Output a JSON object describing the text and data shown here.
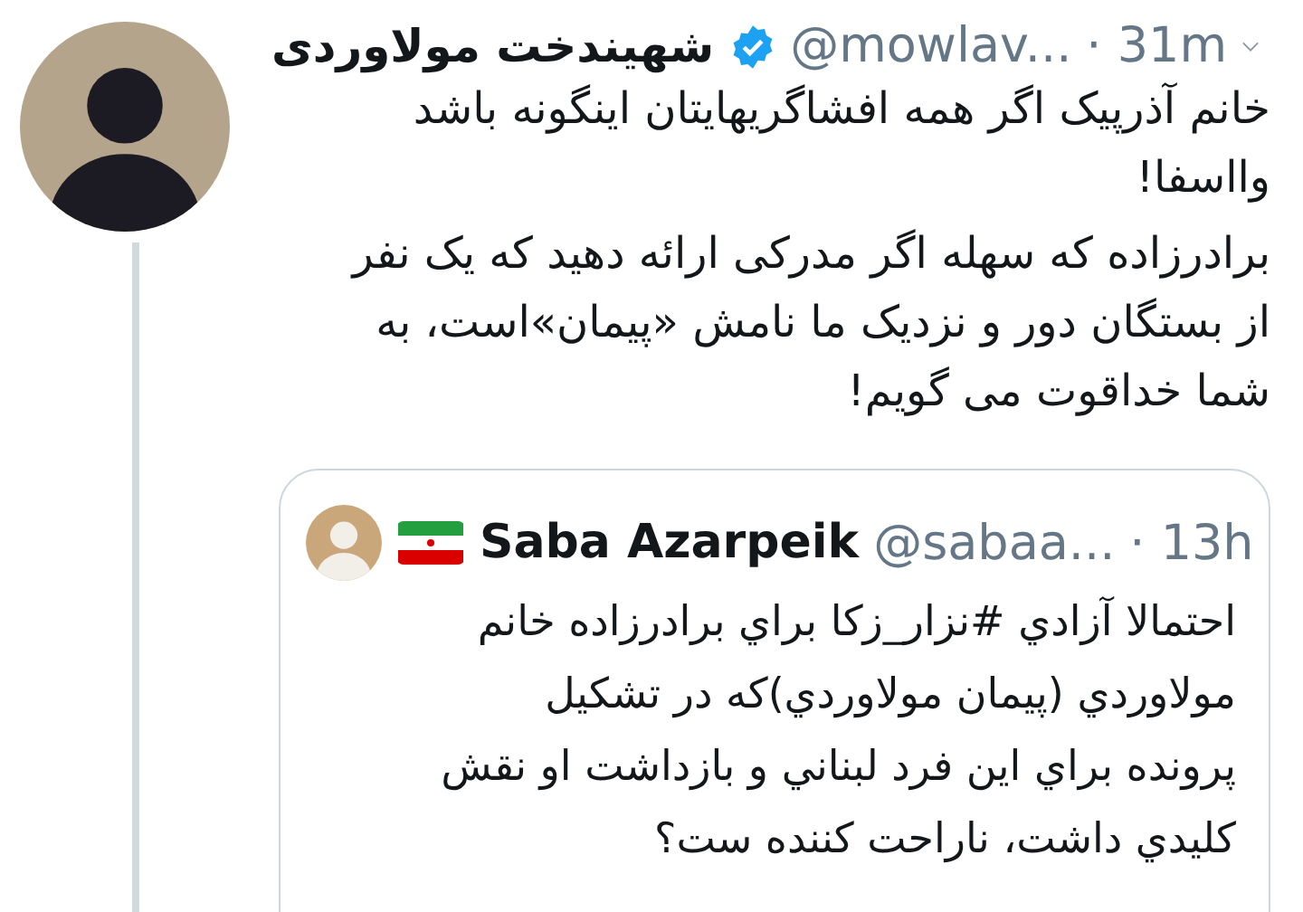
{
  "tweet": {
    "name": "شهیندخت مولاوردی",
    "verified": true,
    "handle": "@mowlav...",
    "time": "· 31m",
    "paragraphs": [
      [
        "خانم آذرپیک اگر همه افشاگریهایتان اینگونه باشد",
        "وااسفا!"
      ],
      [
        "برادرزاده که سهله اگر مدرکی ارائه دهید که یک نفر",
        "از بستگان دور و نزدیک ما نامش «پیمان»است، به",
        "شما خداقوت می گویم!"
      ]
    ]
  },
  "quoted_tweet": {
    "name": "Saba Azarpeik",
    "handle": "@sabaa...",
    "time": "· 13h",
    "lines": [
      "احتمالا آزادي #نزار_زكا براي برادرزاده خانم",
      "مولاوردي (پيمان مولاوردي)که در تشکيل",
      "پرونده براي اين فرد لبناني و بازداشت او نقش",
      "كليدي داشت، ناراحت كننده ست؟"
    ]
  }
}
